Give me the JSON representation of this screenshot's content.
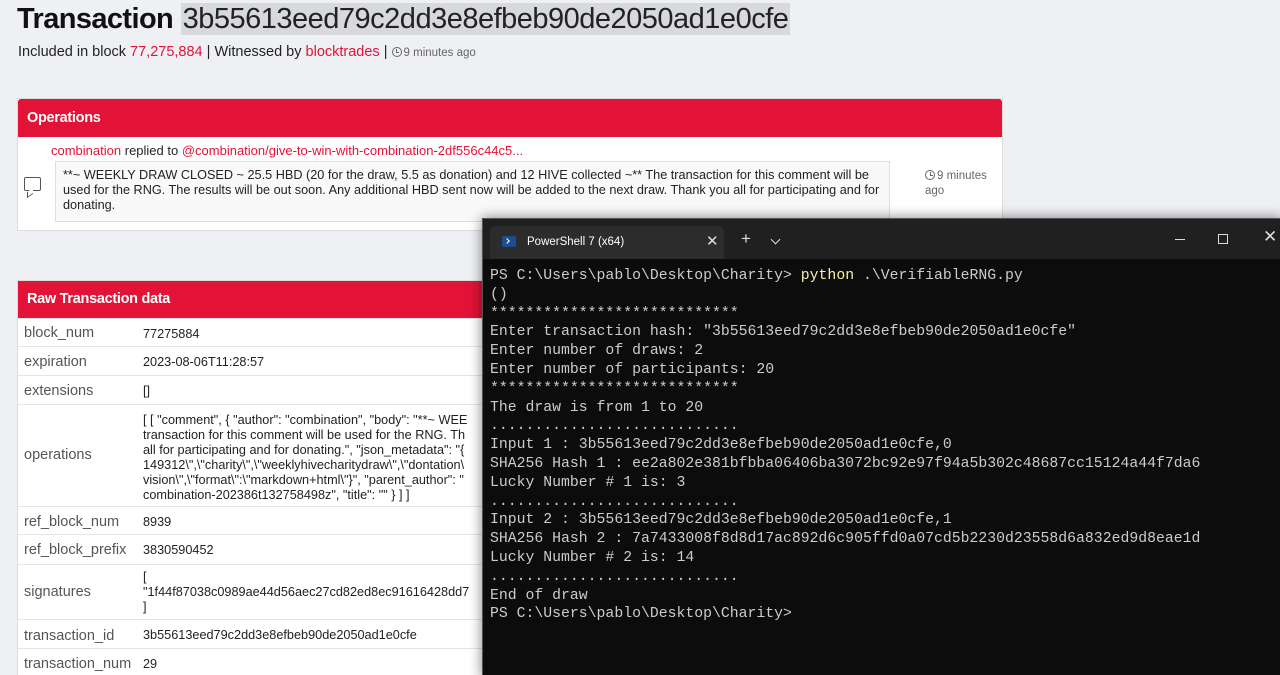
{
  "header": {
    "title_prefix": "Transaction",
    "tx_hash": "3b55613eed79c2dd3e8efbeb90de2050ad1e0cfe",
    "included_text": "Included in block",
    "block_link": "77,275,884",
    "witness_text": "| Witnessed by",
    "witness_link": "blocktrades",
    "sep": "|",
    "time": "9 minutes ago"
  },
  "operations": {
    "title": "Operations",
    "author": "combination",
    "replied_text": "replied to",
    "parent_link": "@combination/give-to-win-with-combination-2df556c44c5...",
    "body": "**~ WEEKLY DRAW CLOSED ~ 25.5 HBD (20 for the draw, 5.5 as donation) and 12 HIVE collected ~** The transaction for this comment will be used for the RNG. The results will be out soon. Any additional HBD sent now will be added to the next draw. Thank you all for participating and for donating.",
    "time": "9 minutes ago"
  },
  "raw": {
    "title": "Raw Transaction data",
    "rows": [
      {
        "key": "block_num",
        "value": "77275884"
      },
      {
        "key": "expiration",
        "value": "2023-08-06T11:28:57"
      },
      {
        "key": "extensions",
        "value": "[]"
      },
      {
        "key": "operations",
        "lines": [
          "[ [ \"comment\", { \"author\": \"combination\", \"body\": \"**~ WEE",
          "transaction for this comment will be used for the RNG. Th",
          "all for participating and for donating.\", \"json_metadata\": \"{",
          "149312\\\",\\\"charity\\\",\\\"weeklyhivecharitydraw\\\",\\\"dontation\\",
          "vision\\\",\\\"format\\\":\\\"markdown+html\\\"}\", \"parent_author\": \"",
          "combination-202386t132758498z\", \"title\": \"\" } ] ]"
        ]
      },
      {
        "key": "ref_block_num",
        "value": "8939"
      },
      {
        "key": "ref_block_prefix",
        "value": "3830590452"
      },
      {
        "key": "signatures",
        "lines": [
          "[",
          "\"1f44f87038c0989ae44d56aec27cd82ed8ec91616428dd7",
          "]"
        ]
      },
      {
        "key": "transaction_id",
        "value": "3b55613eed79c2dd3e8efbeb90de2050ad1e0cfe"
      },
      {
        "key": "transaction_num",
        "value": "29"
      }
    ]
  },
  "terminal": {
    "tab_title": "PowerShell 7 (x64)",
    "prompt": "PS C:\\Users\\pablo\\Desktop\\Charity> ",
    "command": "python",
    "command_arg": " .\\VerifiableRNG.py",
    "lines": [
      "()",
      "****************************",
      "Enter transaction hash: \"3b55613eed79c2dd3e8efbeb90de2050ad1e0cfe\"",
      "Enter number of draws: 2",
      "Enter number of participants: 20",
      "****************************",
      "The draw is from 1 to 20",
      "............................",
      "Input 1 : 3b55613eed79c2dd3e8efbeb90de2050ad1e0cfe,0",
      "SHA256 Hash 1 : ee2a802e381bfbba06406ba3072bc92e97f94a5b302c48687cc15124a44f7da6",
      "Lucky Number # 1 is: 3",
      "............................",
      "Input 2 : 3b55613eed79c2dd3e8efbeb90de2050ad1e0cfe,1",
      "SHA256 Hash 2 : 7a7433008f8d8d17ac892d6c905ffd0a07cd5b2230d23558d6a832ed9d8eae1d",
      "Lucky Number # 2 is: 14",
      "............................",
      "End of draw",
      "PS C:\\Users\\pablo\\Desktop\\Charity>"
    ]
  }
}
